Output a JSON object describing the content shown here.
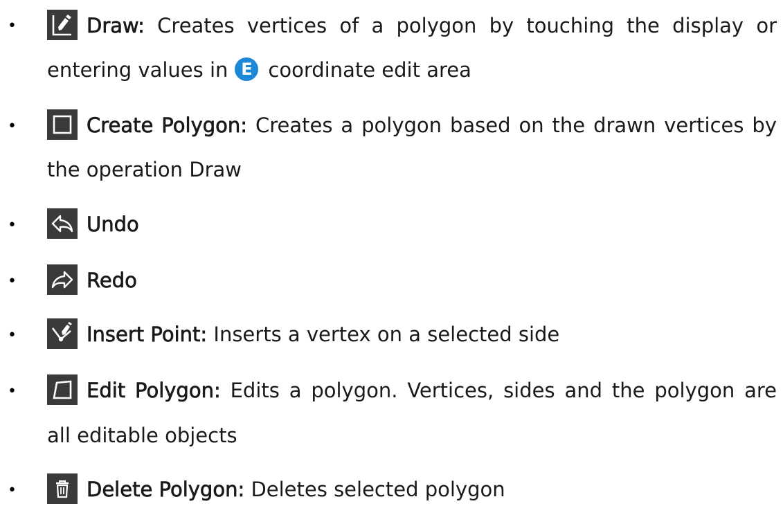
{
  "items": [
    {
      "icon": "draw-pen-icon",
      "term": "Draw:",
      "desc_part1": " Creates vertices of a polygon by touching the display or",
      "desc_line2_before": "entering values in",
      "badge": "E",
      "desc_line2_after": "coordinate edit area"
    },
    {
      "icon": "square-icon",
      "term": "Create Polygon:",
      "desc_part1": " Creates a polygon based on the drawn vertices by",
      "desc_line2": "the operation Draw"
    },
    {
      "icon": "undo-arrow-icon",
      "term": "Undo"
    },
    {
      "icon": "redo-arrow-icon",
      "term": "Redo"
    },
    {
      "icon": "insert-point-icon",
      "term": "Insert Point:",
      "desc_part1": " Inserts a vertex on a selected side"
    },
    {
      "icon": "edit-polygon-icon",
      "term": "Edit Polygon:",
      "desc_part1": " Edits a polygon. Vertices, sides and the polygon are",
      "desc_line2": "all editable objects"
    },
    {
      "icon": "trash-icon",
      "term": "Delete Polygon:",
      "desc_part1": " Deletes selected polygon"
    }
  ],
  "bullet_char": "•",
  "colors": {
    "icon_bg": "#3a3a3a",
    "badge_bg": "#1e88d8",
    "text": "#1a1a1a"
  }
}
